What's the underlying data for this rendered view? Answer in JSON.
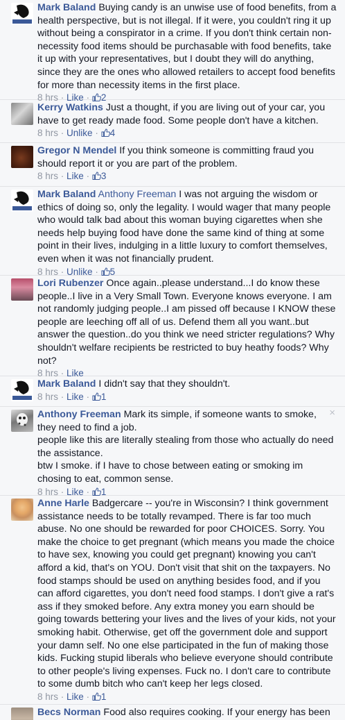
{
  "meta_labels": {
    "time": "8 hrs",
    "separator": "·",
    "like": "Like",
    "unlike": "Unlike"
  },
  "comments": [
    {
      "author": "Mark Baland",
      "mention": "",
      "text": "Buying candy is an unwise use of food benefits, from a health perspective, but is not illegal. If it were, you couldn't ring it up without being a conspirator in a crime. If you don't think certain non-necessity food items should be purchasable with food benefits, take it up with your representatives, but I doubt they will do anything, since they are the ones who allowed retailers to accept food benefits for more than necessity items in the first place.",
      "action": "Like",
      "likes": "2"
    },
    {
      "author": "Kerry Watkins",
      "mention": "",
      "text": "Just a thought, if you are living out of your car, you have to get ready made food. Some people don't have a kitchen.",
      "action": "Unlike",
      "likes": "4"
    },
    {
      "author": "Gregor N Mendel",
      "mention": "",
      "text": "If you think someone is committing fraud you should report it or you are part of the problem.",
      "action": "Like",
      "likes": "3"
    },
    {
      "author": "Mark Baland",
      "mention": "Anthony Freeman",
      "text": "I was not arguing the wisdom or ethics of doing so, only the legality. I would wager that many people who would talk bad about this woman buying cigarettes when she needs help buying food have done the same kind of thing at some point in their lives, indulging in a little luxury to comfort themselves, even when it was not financially prudent.",
      "action": "Unlike",
      "likes": "5"
    },
    {
      "author": "Lori Rubenzer",
      "mention": "",
      "text": "Once again..please understand...I do know these people..I live in a Very Small Town. Everyone knows everyone. I am not randomly judging people..I am pissed off because I KNOW these people are leeching off all of us. Defend them all you want..but answer the question..do you think we need stricter regulations? Why shouldn't welfare recipients be restricted to buy heathy foods? Why not?",
      "action": "Like",
      "likes": ""
    },
    {
      "author": "Mark Baland",
      "mention": "",
      "text": "I didn't say that they shouldn't.",
      "action": "Like",
      "likes": "1"
    },
    {
      "author": "Anthony Freeman",
      "mention": "",
      "text": "Mark its simple, if someone wants to smoke, they need to find a job.",
      "text2": "people like this are literally stealing from those who actually do need the assistance.",
      "text3": "btw I smoke. if I have to chose between eating or smoking im chosing to eat, common sense.",
      "action": "Like",
      "likes": "1",
      "close": "×"
    },
    {
      "author": "Anne Harle",
      "mention": "",
      "text": "Badgercare -- you're in Wisconsin? I think government assistance needs to be totally revamped. There is far too much abuse. No one should be rewarded for poor CHOICES. Sorry. You make the choice to get pregnant (which means you made the choice to have sex, knowing you could get pregnant) knowing you can't afford a kid, that's on YOU. Don't visit that shit on the taxpayers. No food stamps should be used on anything besides food, and if you can afford cigarettes, you don't need food stamps. I don't give a rat's ass if they smoked before. Any extra money you earn should be going towards bettering your lives and the lives of your kids, not your smoking habit. Otherwise, get off the government dole and support your damn self. No one else participated in the fun of making those kids. Fucking stupid liberals who believe everyone should contribute to other people's living expenses. Fuck no. I don't care to contribute to some dumb bitch who can't keep her legs closed.",
      "action": "Like",
      "likes": "1"
    },
    {
      "author": "Becs Norman",
      "mention": "",
      "text": "Food also requires cooking. If your energy has been",
      "action": "",
      "likes": ""
    }
  ],
  "colors": {
    "link": "#3b5998",
    "meta": "#9197a3",
    "background": "#f6f7f9"
  }
}
